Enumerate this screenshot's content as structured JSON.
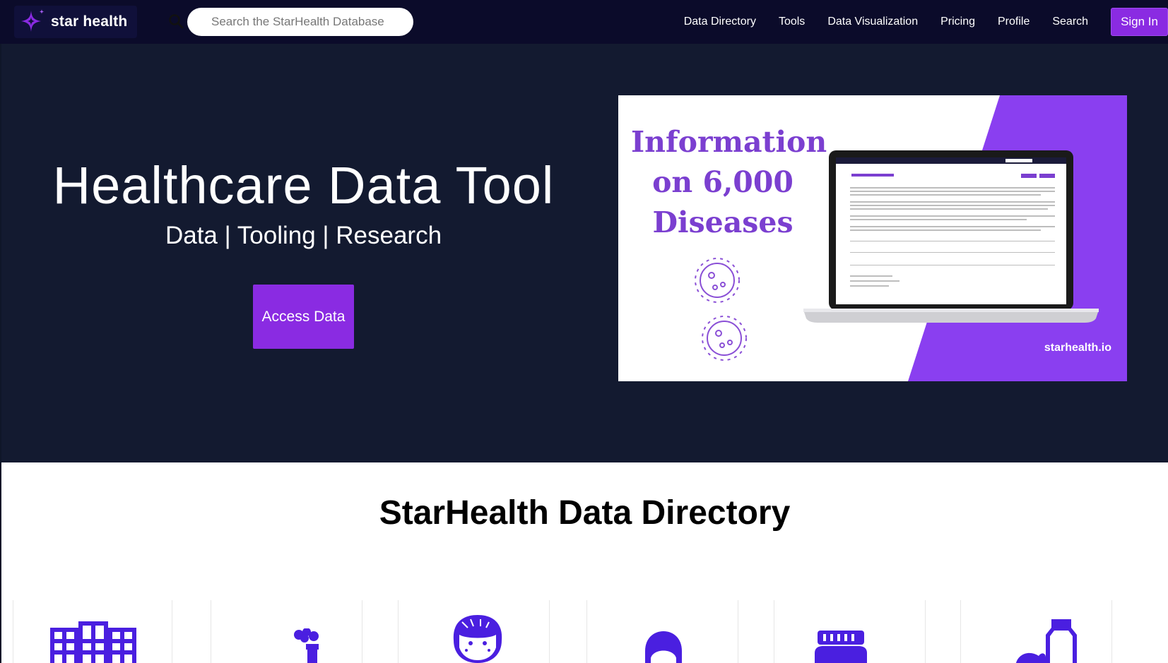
{
  "nav": {
    "logo_text": "star health",
    "search_placeholder": "Search the StarHealth Database",
    "links": [
      "Data Directory",
      "Tools",
      "Data Visualization",
      "Pricing",
      "Profile",
      "Search"
    ],
    "sign_in": "Sign In"
  },
  "hero": {
    "title": "Healthcare Data Tool",
    "subtitle": "Data | Tooling | Research",
    "cta": "Access Data"
  },
  "promo": {
    "headline": [
      "Information",
      "on 6,000",
      "Diseases"
    ],
    "url": "starhealth.io"
  },
  "directory": {
    "title": "StarHealth Data Directory",
    "icons": [
      "hospital-building-icon",
      "factory-icon",
      "child-face-icon",
      "person-head-icon",
      "pill-jar-icon",
      "bottle-icon"
    ]
  },
  "colors": {
    "accent": "#8a2be2",
    "nav_bg": "#0b0b2a",
    "hero_bg": "#131a30",
    "icon_blue": "#4a1fe0"
  }
}
